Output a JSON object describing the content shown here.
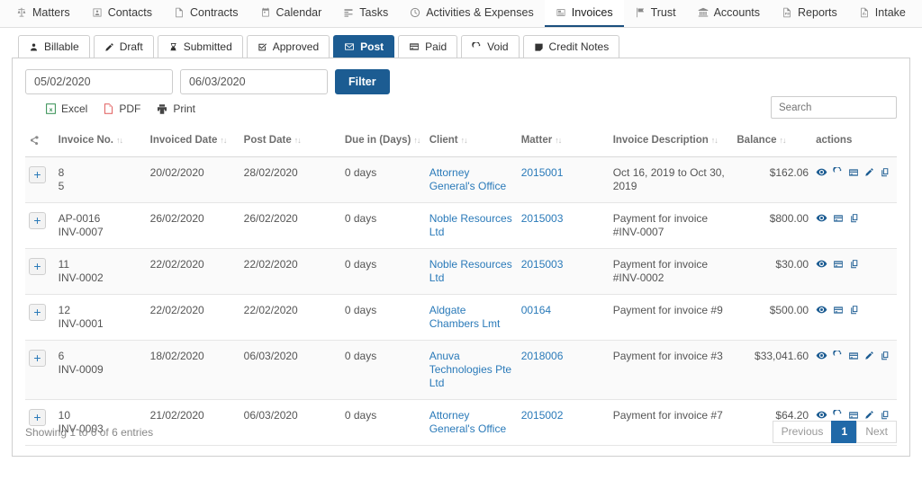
{
  "topnav": {
    "items": [
      {
        "label": "Matters",
        "icon": "scales-icon",
        "active": false
      },
      {
        "label": "Contacts",
        "icon": "contact-card-icon",
        "active": false
      },
      {
        "label": "Contracts",
        "icon": "document-icon",
        "active": false
      },
      {
        "label": "Calendar",
        "icon": "calendar-icon",
        "active": false
      },
      {
        "label": "Tasks",
        "icon": "list-icon",
        "active": false
      },
      {
        "label": "Activities & Expenses",
        "icon": "clock-icon",
        "active": false
      },
      {
        "label": "Invoices",
        "icon": "invoice-icon",
        "active": true
      },
      {
        "label": "Trust",
        "icon": "flag-icon",
        "active": false
      },
      {
        "label": "Accounts",
        "icon": "bank-icon",
        "active": false
      },
      {
        "label": "Reports",
        "icon": "report-pdf-icon",
        "active": false
      },
      {
        "label": "Intake",
        "icon": "chart-doc-icon",
        "active": false
      }
    ]
  },
  "tabs": [
    {
      "label": "Billable",
      "icon": "person-icon",
      "active": false
    },
    {
      "label": "Draft",
      "icon": "pencil-icon",
      "active": false
    },
    {
      "label": "Submitted",
      "icon": "hourglass-icon",
      "active": false
    },
    {
      "label": "Approved",
      "icon": "check-square-icon",
      "active": false
    },
    {
      "label": "Post",
      "icon": "envelope-icon",
      "active": true
    },
    {
      "label": "Paid",
      "icon": "credit-card-icon",
      "active": false
    },
    {
      "label": "Void",
      "icon": "refresh-icon",
      "active": false
    },
    {
      "label": "Credit Notes",
      "icon": "note-icon",
      "active": false
    }
  ],
  "filter": {
    "date_from": "05/02/2020",
    "date_to": "06/03/2020",
    "date_from_placeholder": "dd/mm/yyyy",
    "date_to_placeholder": "dd/mm/yyyy",
    "button_label": "Filter"
  },
  "exports": [
    {
      "label": "Excel",
      "icon": "excel-icon"
    },
    {
      "label": "PDF",
      "icon": "pdf-icon"
    },
    {
      "label": "Print",
      "icon": "printer-icon"
    }
  ],
  "search": {
    "value": "",
    "placeholder": "Search"
  },
  "table": {
    "columns": [
      {
        "label": "",
        "sortable": false
      },
      {
        "label": "Invoice No.",
        "sortable": true
      },
      {
        "label": "Invoiced Date",
        "sortable": true
      },
      {
        "label": "Post Date",
        "sortable": true
      },
      {
        "label": "Due in (Days)",
        "sortable": true
      },
      {
        "label": "Client",
        "sortable": true
      },
      {
        "label": "Matter",
        "sortable": true
      },
      {
        "label": "Invoice Description",
        "sortable": true
      },
      {
        "label": "Balance",
        "sortable": true
      },
      {
        "label": "actions",
        "sortable": false
      }
    ],
    "sort_glyph": "↑↓",
    "expand_glyph": "+",
    "rows": [
      {
        "invoice_no_1": "8",
        "invoice_no_2": "5",
        "invoiced_date": "20/02/2020",
        "post_date": "28/02/2020",
        "due_in": "0 days",
        "client": "Attorney General's Office",
        "matter": "2015001",
        "description": "Oct 16, 2019 to Oct 30, 2019",
        "balance": "$162.06",
        "actions": [
          "eye-icon",
          "refresh-icon",
          "credit-card-icon",
          "pencil-icon",
          "copy-icon"
        ]
      },
      {
        "invoice_no_1": "AP-0016",
        "invoice_no_2": "INV-0007",
        "invoiced_date": "26/02/2020",
        "post_date": "26/02/2020",
        "due_in": "0 days",
        "client": "Noble Resources Ltd",
        "matter": "2015003",
        "description": "Payment for invoice #INV-0007",
        "balance": "$800.00",
        "actions": [
          "eye-icon",
          "credit-card-icon",
          "copy-icon"
        ]
      },
      {
        "invoice_no_1": "11",
        "invoice_no_2": "INV-0002",
        "invoiced_date": "22/02/2020",
        "post_date": "22/02/2020",
        "due_in": "0 days",
        "client": "Noble Resources Ltd",
        "matter": "2015003",
        "description": "Payment for invoice #INV-0002",
        "balance": "$30.00",
        "actions": [
          "eye-icon",
          "credit-card-icon",
          "copy-icon"
        ]
      },
      {
        "invoice_no_1": "12",
        "invoice_no_2": "INV-0001",
        "invoiced_date": "22/02/2020",
        "post_date": "22/02/2020",
        "due_in": "0 days",
        "client": "Aldgate Chambers Lmt",
        "matter": "00164",
        "description": "Payment for invoice #9",
        "balance": "$500.00",
        "actions": [
          "eye-icon",
          "credit-card-icon",
          "copy-icon"
        ]
      },
      {
        "invoice_no_1": "6",
        "invoice_no_2": "INV-0009",
        "invoiced_date": "18/02/2020",
        "post_date": "06/03/2020",
        "due_in": "0 days",
        "client": "Anuva Technologies Pte Ltd",
        "matter": "2018006",
        "description": "Payment for invoice #3",
        "balance": "$33,041.60",
        "actions": [
          "eye-icon",
          "refresh-icon",
          "credit-card-icon",
          "pencil-icon",
          "copy-icon"
        ]
      },
      {
        "invoice_no_1": "10",
        "invoice_no_2": "INV-0003",
        "invoiced_date": "21/02/2020",
        "post_date": "06/03/2020",
        "due_in": "0 days",
        "client": "Attorney General's Office",
        "matter": "2015002",
        "description": "Payment for invoice #7",
        "balance": "$64.20",
        "actions": [
          "eye-icon",
          "refresh-icon",
          "credit-card-icon",
          "pencil-icon",
          "copy-icon"
        ]
      }
    ]
  },
  "footer": {
    "showing": "Showing 1 to 6 of 6 entries",
    "previous_label": "Previous",
    "page_label": "1",
    "next_label": "Next"
  },
  "colors": {
    "accent": "#1c5c92",
    "link": "#2a7ab9",
    "page_active": "#2069a8"
  }
}
